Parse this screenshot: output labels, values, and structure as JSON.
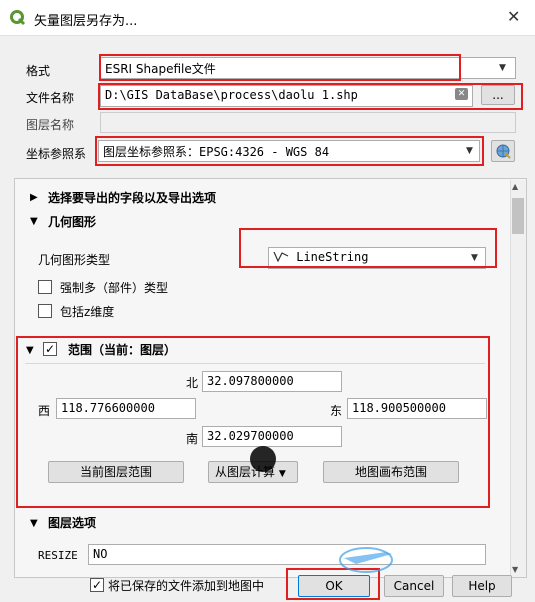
{
  "window": {
    "title": "矢量图层另存为..."
  },
  "form": {
    "format_label": "格式",
    "format_value": "ESRI Shapefile文件",
    "filename_label": "文件名称",
    "filename_value": "D:\\GIS DataBase\\process\\daolu 1.shp",
    "browse_label": "...",
    "layername_label": "图层名称",
    "layername_value": "",
    "crs_label": "坐标参照系",
    "crs_value": "图层坐标参照系：EPSG:4326 - WGS 84"
  },
  "sections": {
    "fields_label": "选择要导出的字段以及导出选项",
    "geometry_label": "几何图形",
    "geometry_type_label": "几何图形类型",
    "geometry_type_value": "LineString",
    "force_multi_label": "强制多（部件）类型",
    "include_z_label": "包括z维度",
    "extent_label": "范围（当前：图层）",
    "layer_options_label": "图层选项"
  },
  "extent": {
    "north_label": "北",
    "north_value": "32.097800000",
    "west_label": "西",
    "west_value": "118.776600000",
    "east_label": "东",
    "east_value": "118.900500000",
    "south_label": "南",
    "south_value": "32.029700000",
    "current_layer_btn": "当前图层范围",
    "from_layer_btn": "从图层计算",
    "canvas_btn": "地图画布范围"
  },
  "layer_options": {
    "resize_label": "RESIZE",
    "resize_value": "NO"
  },
  "footer": {
    "add_to_map_label": "将已保存的文件添加到地图中",
    "ok_label": "OK",
    "cancel_label": "Cancel",
    "help_label": "Help"
  },
  "colors": {
    "highlight": "#e02020",
    "qgis_green": "#589632"
  }
}
